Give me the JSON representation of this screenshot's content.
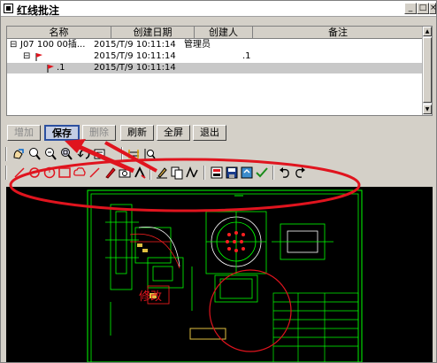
{
  "window": {
    "title": "红线批注",
    "min_label": "_",
    "max_label": "□",
    "close_label": "×"
  },
  "grid": {
    "columns": [
      "名称",
      "创建日期",
      "创建人",
      "备注"
    ],
    "rows": [
      {
        "expander": "⊟",
        "name": "J07 100 00插...",
        "date": "2015/T/9 10:11:14",
        "creator": "管理员",
        "note": ""
      },
      {
        "expander": "⊟",
        "name": "",
        "date": "2015/T/9 10:11:14",
        "creator": "",
        "note": ".1"
      },
      {
        "expander": "",
        "name": ".1",
        "date": "2015/T/9 10:11:14",
        "creator": "",
        "note": ""
      }
    ]
  },
  "buttons": {
    "add": "增加",
    "save": "保存",
    "delete": "删除",
    "refresh": "刷新",
    "fullscreen": "全屏",
    "exit": "退出"
  },
  "drawing": {
    "markup_label": "修改"
  },
  "colors": {
    "annotation_red": "#e0141e",
    "cad_green": "#00ff00",
    "cad_red": "#ff2020",
    "selection_blue": "#2c50a0"
  },
  "icons": {
    "toolbar1": [
      "hand-icon",
      "zoom-in-icon",
      "zoom-out-icon",
      "zoom-window-icon",
      "rotate-icon",
      "fit-icon",
      "page-width-icon",
      "page-height-icon"
    ],
    "toolbar2": [
      "line-icon",
      "circle-icon",
      "ellipse-icon",
      "rectangle-icon",
      "cloud-icon",
      "arrow-icon",
      "pen-icon",
      "camera-icon",
      "text-icon",
      "highlighter-icon",
      "copy-icon",
      "font-icon",
      "layer-icon",
      "save-icon",
      "export-icon",
      "check-icon",
      "undo-icon",
      "redo-icon"
    ]
  }
}
